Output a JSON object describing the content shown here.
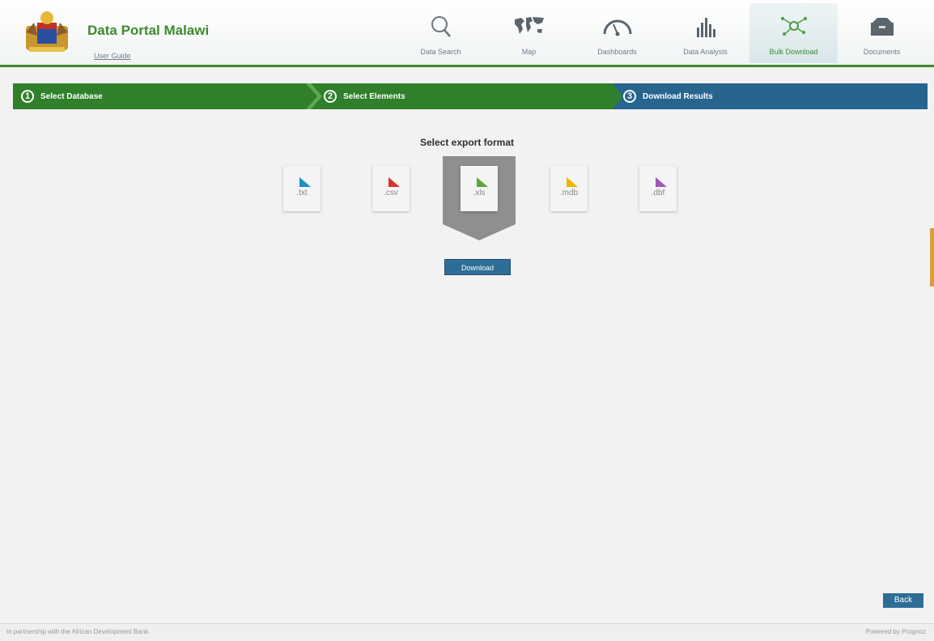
{
  "brand": {
    "title": "Data Portal Malawi",
    "user_guide": "User Guide"
  },
  "nav": [
    {
      "label": "Data Search",
      "icon": "search-icon"
    },
    {
      "label": "Map",
      "icon": "world-map-icon"
    },
    {
      "label": "Dashboards",
      "icon": "gauge-icon"
    },
    {
      "label": "Data Analysis",
      "icon": "bar-chart-icon"
    },
    {
      "label": "Bulk Download",
      "icon": "network-icon",
      "active": true
    },
    {
      "label": "Documents",
      "icon": "archive-box-icon"
    }
  ],
  "steps": [
    {
      "num": "1",
      "label": "Select Database"
    },
    {
      "num": "2",
      "label": "Select Elements"
    },
    {
      "num": "3",
      "label": "Download Results",
      "active": true
    }
  ],
  "export": {
    "title": "Select export format",
    "formats": [
      {
        "ext": ".txt",
        "color": "#1e90c8"
      },
      {
        "ext": ".csv",
        "color": "#d9362b"
      },
      {
        "ext": ".xls",
        "color": "#5aa83c",
        "selected": true
      },
      {
        "ext": ".mdb",
        "color": "#f0b400"
      },
      {
        "ext": ".dbf",
        "color": "#9b59b6"
      }
    ],
    "download_label": "Download"
  },
  "back_label": "Back",
  "footer": {
    "left": "In partnership with the African Development Bank",
    "right": "Powered by Prognoz"
  },
  "colors": {
    "green": "#3d8a2e",
    "blue": "#27658f",
    "orange": "#e49a3b"
  }
}
